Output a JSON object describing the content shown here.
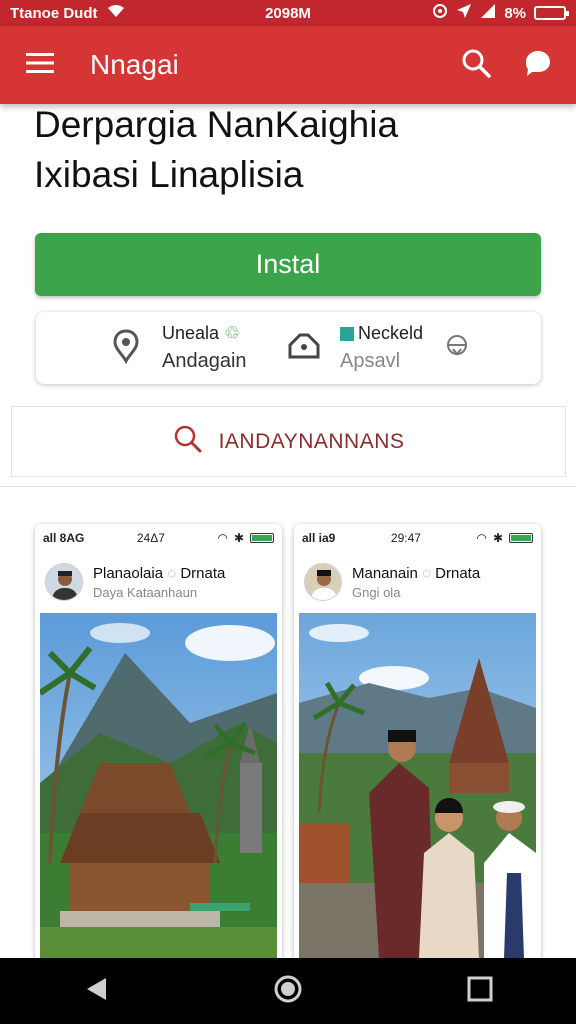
{
  "status_bar": {
    "left_text": "Ttanoe Dudt",
    "time": "2098M",
    "battery_text": "8%"
  },
  "app_bar": {
    "title": "Nnagai"
  },
  "page": {
    "title_line1": "Derpargia NanKaighia",
    "title_line2": "Ixibasi Linaplisia"
  },
  "install": {
    "label": "Instal"
  },
  "info": {
    "left_top": "Uneala",
    "left_bottom": "Andagain",
    "right_top": "Neckeld",
    "right_bottom": "Apsavl"
  },
  "search": {
    "text": "IANDAYNANNANS"
  },
  "screenshots": [
    {
      "signal": "all 8AG",
      "time": "24Δ7",
      "name": "Planaolaia",
      "name_suffix": "Drnata",
      "sub": "Daya Kataanhaun"
    },
    {
      "signal": "all ia9",
      "time": "29:47",
      "name": "Mananain",
      "name_suffix": "Drnata",
      "sub": "Gngi ola"
    }
  ],
  "colors": {
    "status_bar": "#c2272d",
    "app_bar": "#d63535",
    "install": "#3ba34a",
    "search_text": "#8a2c2c",
    "nav_bar": "#000000"
  }
}
